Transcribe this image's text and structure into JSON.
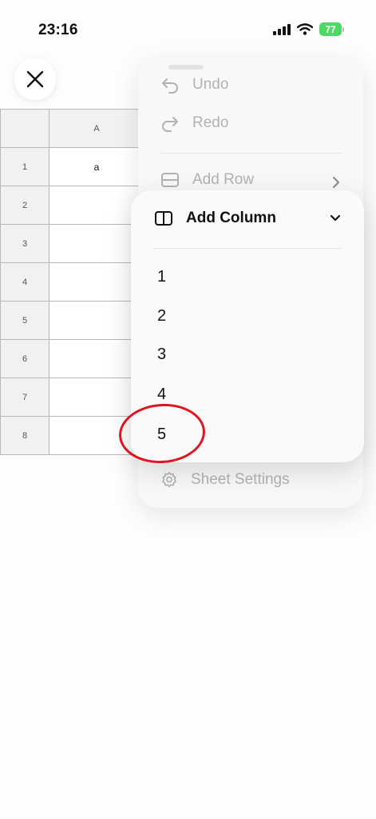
{
  "status_bar": {
    "time": "23:16",
    "battery": "77",
    "icons": [
      "cellular-signal-icon",
      "wifi-icon",
      "battery-charging-icon"
    ]
  },
  "close_button": {
    "icon": "close-icon"
  },
  "sheet": {
    "column_headers": [
      "A"
    ],
    "rows": [
      {
        "number": "1",
        "A": "a"
      },
      {
        "number": "2",
        "A": ""
      },
      {
        "number": "3",
        "A": ""
      },
      {
        "number": "4",
        "A": ""
      },
      {
        "number": "5",
        "A": ""
      },
      {
        "number": "6",
        "A": ""
      },
      {
        "number": "7",
        "A": ""
      },
      {
        "number": "8",
        "A": ""
      }
    ]
  },
  "menu": {
    "undo_label": "Undo",
    "redo_label": "Redo",
    "add_row_label": "Add Row",
    "sheet_settings_label": "Sheet Settings"
  },
  "submenu": {
    "title": "Add Column",
    "options": [
      "1",
      "2",
      "3",
      "4",
      "5"
    ]
  },
  "colors": {
    "annotation": "#e0141e",
    "battery": "#4cd964"
  }
}
